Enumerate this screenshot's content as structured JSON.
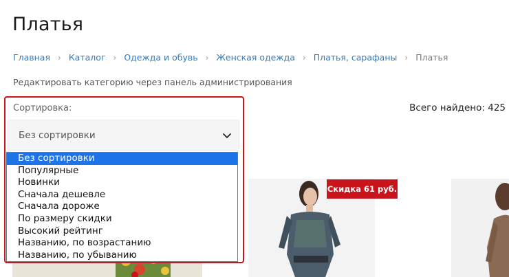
{
  "page": {
    "title": "Платья",
    "admin_link": "Редактировать категорию через панель администрирования"
  },
  "breadcrumb": {
    "items": [
      "Главная",
      "Каталог",
      "Одежда и обувь",
      "Женская одежда",
      "Платья, сарафаны"
    ],
    "current": "Платья",
    "separator": "›"
  },
  "sorting": {
    "label": "Сортировка:",
    "selected": "Без сортировки",
    "options": [
      "Без сортировки",
      "Популярные",
      "Новинки",
      "Сначала дешевле",
      "Сначала дороже",
      "По размеру скидки",
      "Высокий рейтинг",
      "Названию, по возрастанию",
      "Названию, по убыванию"
    ],
    "highlight_color": "#c8141a"
  },
  "results": {
    "total": "Всего найдено: 425"
  },
  "products": [
    {
      "image": "floral-dress-photo"
    },
    {
      "image": "woman-in-patterned-dress-photo",
      "badge": "Скидка 61 руб."
    },
    {
      "image": "woman-in-brown-dress-photo"
    }
  ],
  "colors": {
    "link": "#2f7bc1",
    "selected_option_bg": "#1e73e8",
    "badge_bg": "#c8141a"
  }
}
